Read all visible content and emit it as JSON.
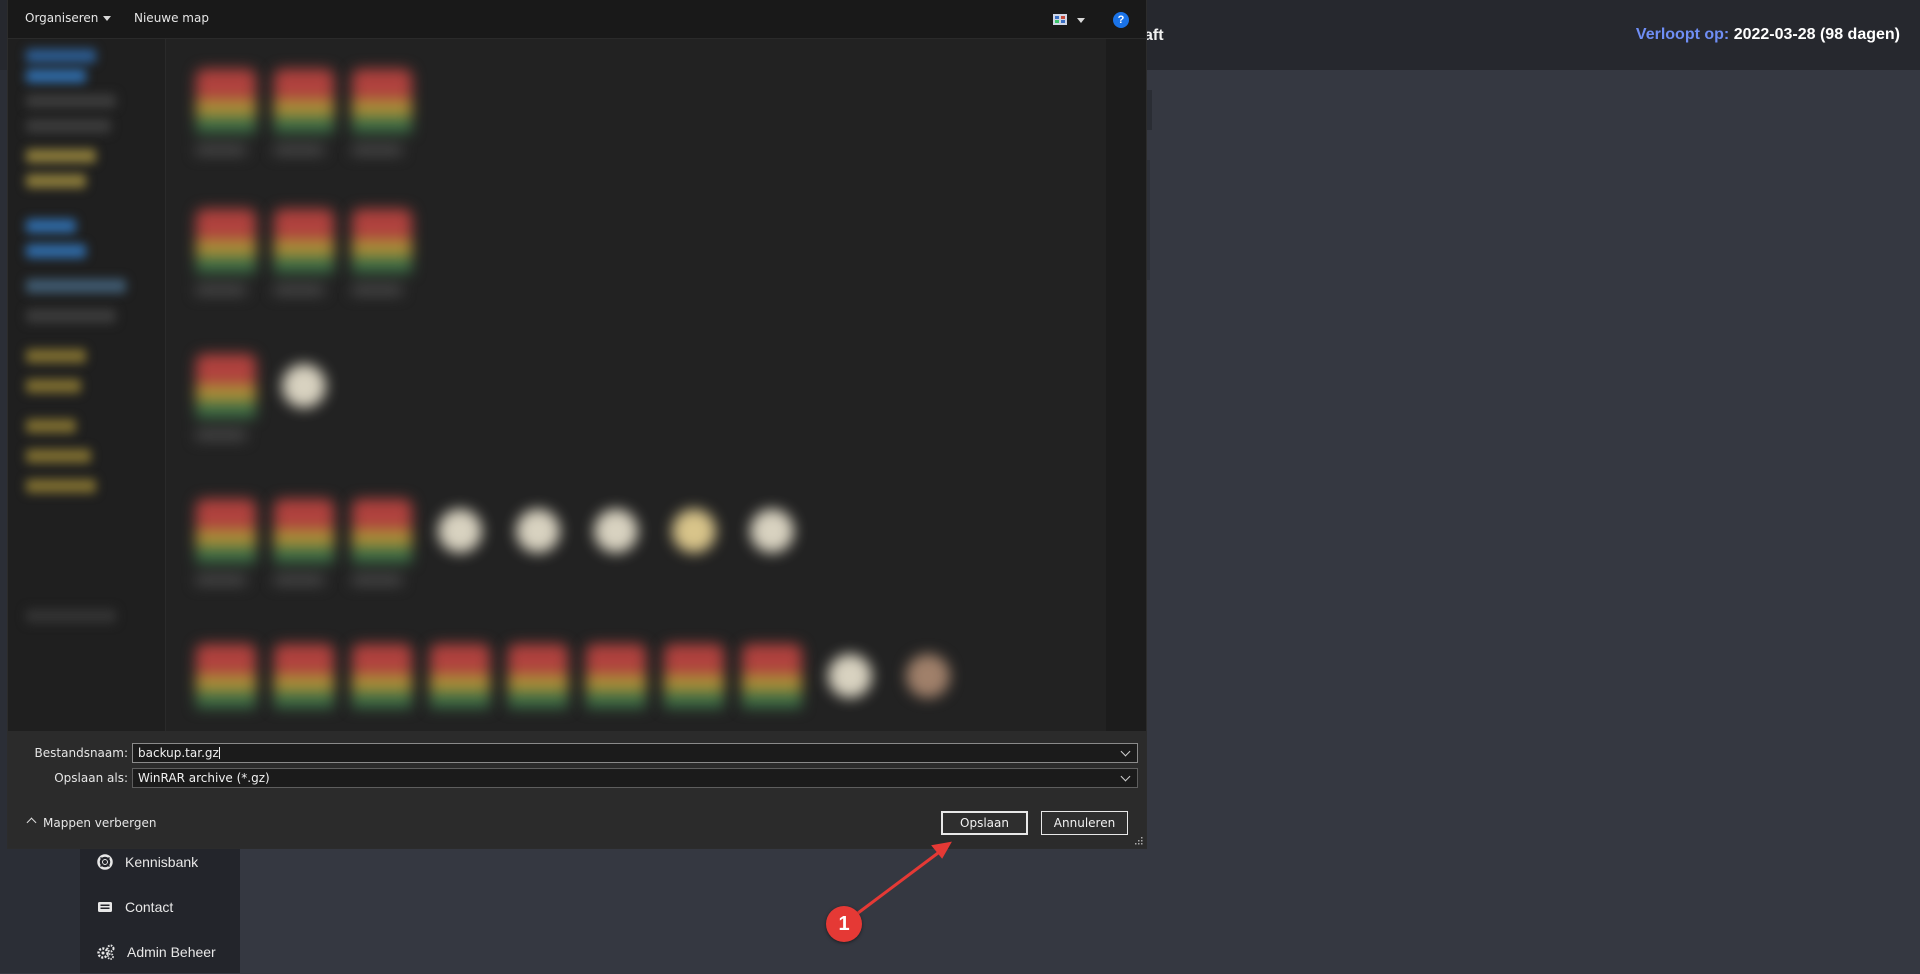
{
  "app": {
    "header_title_fragment": "aft",
    "expiry_label": "Verloopt op:",
    "expiry_value": "2022-03-28 (98 dagen)",
    "sidebar": [
      {
        "label": "Kennisbank",
        "icon": "lifebuoy-icon"
      },
      {
        "label": "Contact",
        "icon": "contact-card-icon"
      },
      {
        "label": "Admin Beheer",
        "icon": "cogs-icon"
      }
    ]
  },
  "dialog": {
    "toolbar": {
      "organise_label": "Organiseren",
      "new_folder_label": "Nieuwe map",
      "view_icon": "view-options-icon",
      "help_icon": "help-icon",
      "help_glyph": "?"
    },
    "filename_label": "Bestandsnaam:",
    "filename_value": "backup.tar.gz",
    "save_as_label": "Opslaan als:",
    "save_as_value": "WinRAR archive (*.gz)",
    "hide_folders_label": "Mappen verbergen",
    "save_button": "Opslaan",
    "cancel_button": "Annuleren"
  },
  "annotation": {
    "badge_number": "1",
    "color": "#e53935"
  },
  "colors": {
    "accent_blue": "#6f8ef5",
    "dialog_bg": "#1b1b1b",
    "page_bg": "#353841"
  }
}
